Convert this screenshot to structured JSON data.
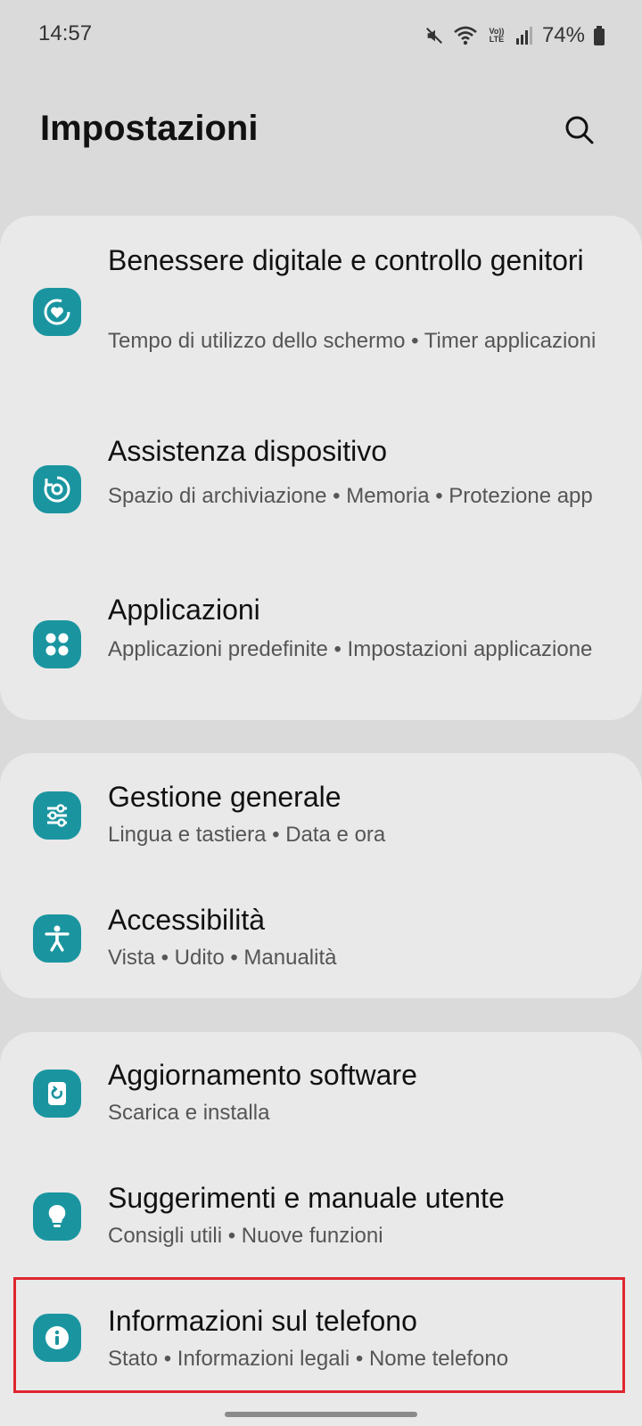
{
  "status_bar": {
    "time": "14:57",
    "volte_label": "Vo)) LTE",
    "battery_percent": "74%",
    "icons": [
      "mute-icon",
      "wifi-icon",
      "volte-icon",
      "signal-icon",
      "battery-icon"
    ]
  },
  "header": {
    "title": "Impostazioni",
    "search_icon": "search-icon"
  },
  "accent_color": "#1a95a0",
  "highlight_color": "#e0262e",
  "groups": [
    {
      "items": [
        {
          "title": "Benessere digitale e controllo genitori",
          "subtitle": "Tempo di utilizzo dello schermo • Timer applicazioni",
          "icon": "digital-wellbeing-icon"
        },
        {
          "title": "Assistenza dispositivo",
          "subtitle": "Spazio di archiviazione • Memoria • Protezione app",
          "icon": "device-care-icon"
        },
        {
          "title": "Applicazioni",
          "subtitle": "Applicazioni predefinite • Impostazioni applicazione",
          "icon": "apps-icon"
        }
      ]
    },
    {
      "items": [
        {
          "title": "Gestione generale",
          "subtitle": "Lingua e tastiera • Data e ora",
          "icon": "sliders-icon"
        },
        {
          "title": "Accessibilità",
          "subtitle": "Vista • Udito • Manualità",
          "icon": "accessibility-icon"
        }
      ]
    },
    {
      "items": [
        {
          "title": "Aggiornamento software",
          "subtitle": "Scarica e installa",
          "icon": "software-update-icon"
        },
        {
          "title": "Suggerimenti e manuale utente",
          "subtitle": "Consigli utili • Nuove funzioni",
          "icon": "lightbulb-icon"
        },
        {
          "title": "Informazioni sul telefono",
          "subtitle": "Stato • Informazioni legali • Nome telefono",
          "icon": "info-icon",
          "highlighted": true
        }
      ]
    }
  ]
}
